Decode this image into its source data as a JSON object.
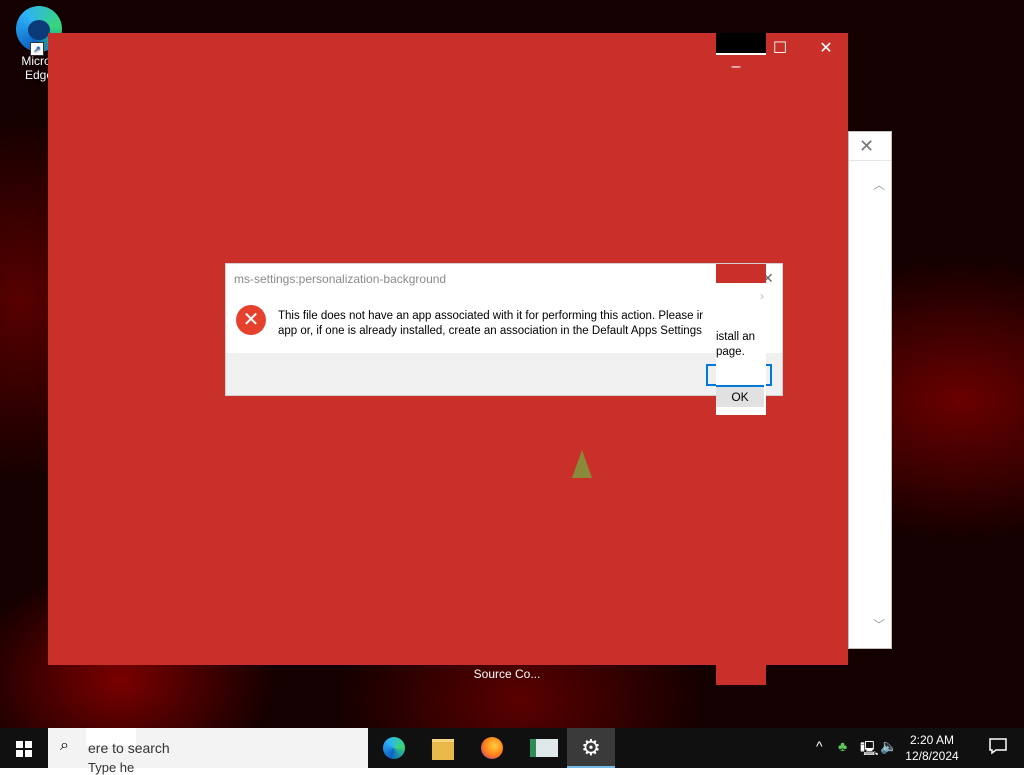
{
  "desktop": {
    "icons": [
      {
        "label_line1": "Micros",
        "label_line2": "Edge"
      }
    ],
    "source_label": "Source Co..."
  },
  "dialog": {
    "title": "ms-settings:personalization-background",
    "message_line1": "This file does not have an app associated with it for performing this action. Please ir",
    "message_line2": "app or, if one is already installed, create an association in the Default Apps Settings",
    "fragment_line1": "istall an",
    "fragment_line2": "page.",
    "ok_label": "OK"
  },
  "taskbar": {
    "search_placeholder": "ere to search",
    "search_ghost": "Type he",
    "apps": [
      {
        "name": "edge",
        "active": false
      },
      {
        "name": "file-explorer",
        "active": false
      },
      {
        "name": "firefox",
        "active": false
      },
      {
        "name": "notepad-like",
        "active": false
      },
      {
        "name": "settings",
        "active": true
      }
    ],
    "clock_time": "2:20 AM",
    "clock_date": "12/8/2024"
  },
  "colors": {
    "window_red": "#c9302a",
    "error_red": "#e5412d",
    "focus_blue": "#0078d7"
  }
}
